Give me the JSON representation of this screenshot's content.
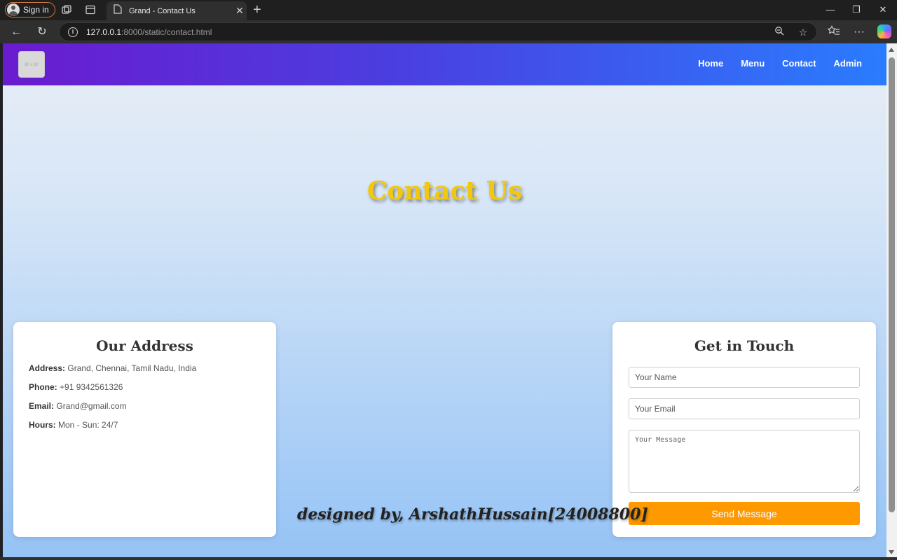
{
  "browser": {
    "signin_label": "Sign in",
    "tab_title": "Grand - Contact Us",
    "url_host": "127.0.0.1",
    "url_rest": ":8000/static/contact.html"
  },
  "site": {
    "logo_text": "80 x 80",
    "nav": [
      "Home",
      "Menu",
      "Contact",
      "Admin"
    ],
    "hero_title": "Contact Us"
  },
  "address_card": {
    "title": "Our Address",
    "rows": [
      {
        "label": "Address:",
        "value": "Grand, Chennai, Tamil Nadu, India"
      },
      {
        "label": "Phone:",
        "value": "+91 9342561326"
      },
      {
        "label": "Email:",
        "value": "Grand@gmail.com"
      },
      {
        "label": "Hours:",
        "value": "Mon - Sun: 24/7"
      }
    ]
  },
  "contact_form": {
    "title": "Get in Touch",
    "name_placeholder": "Your Name",
    "email_placeholder": "Your Email",
    "message_placeholder": "Your Message",
    "submit_label": "Send Message"
  },
  "credit": "designed by, ArshathHussain[24008800]",
  "colors": {
    "nav_start": "#6a1bd0",
    "nav_end": "#2a7cff",
    "hero_title": "#f2c80f",
    "submit_button": "#ff9900"
  }
}
